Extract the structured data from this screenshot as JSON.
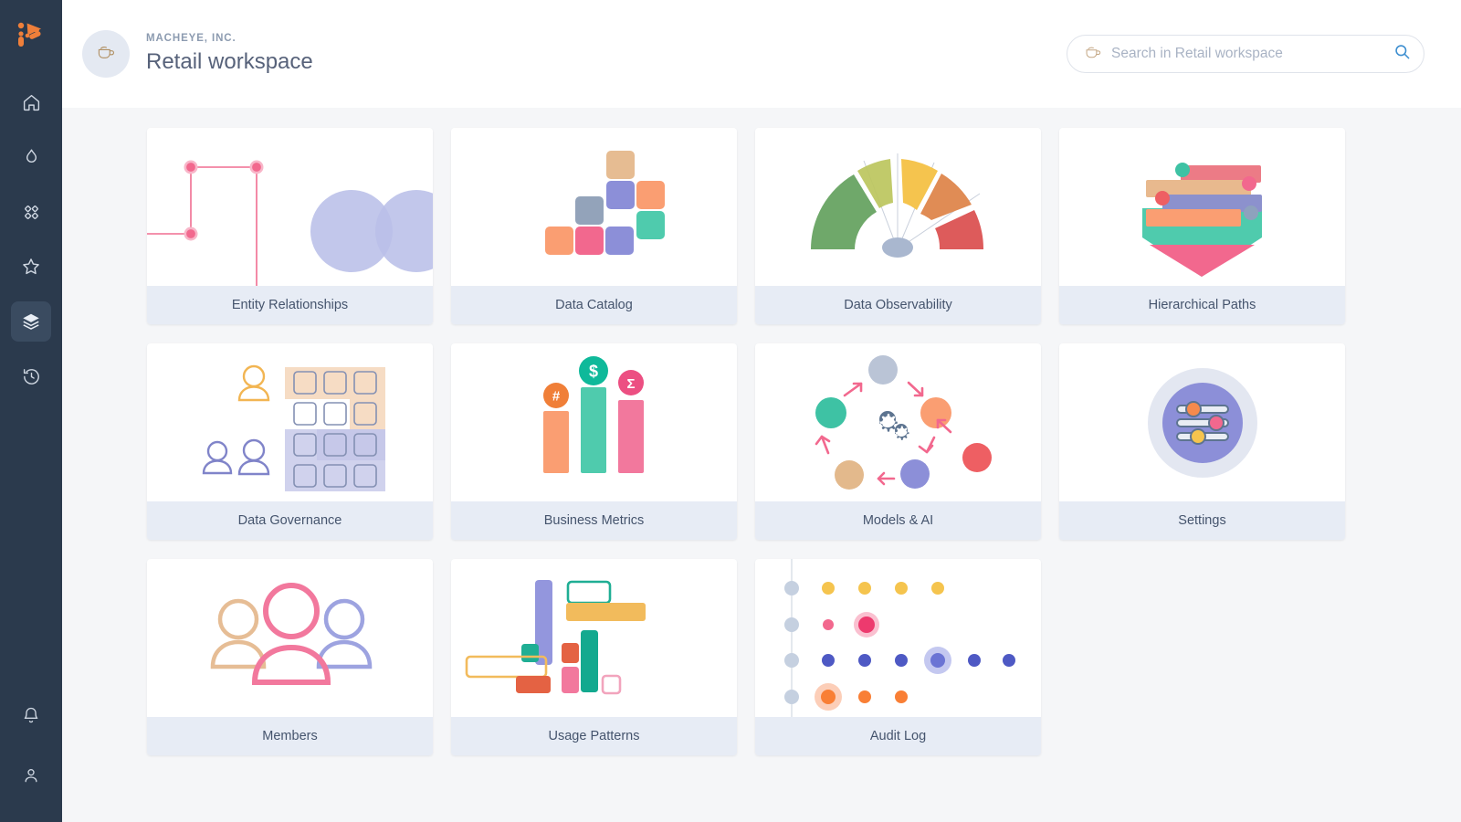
{
  "sidebar": {
    "logo_icon": "macheye-logo-icon",
    "items": [
      {
        "icon": "home-icon",
        "name": "home",
        "active": false
      },
      {
        "icon": "spark-icon",
        "name": "insights",
        "active": false
      },
      {
        "icon": "diamond-grid-icon",
        "name": "apps",
        "active": false
      },
      {
        "icon": "star-icon",
        "name": "favorites",
        "active": false
      },
      {
        "icon": "layers-icon",
        "name": "workspaces",
        "active": true
      },
      {
        "icon": "history-icon",
        "name": "history",
        "active": false
      }
    ],
    "bottom_items": [
      {
        "icon": "bell-icon",
        "name": "notifications"
      },
      {
        "icon": "user-icon",
        "name": "profile"
      }
    ]
  },
  "header": {
    "avatar_icon": "coffee-cup-icon",
    "org": "MACHEYE, INC.",
    "title": "Retail workspace"
  },
  "search": {
    "icon": "coffee-cup-icon",
    "placeholder": "Search in Retail workspace",
    "value": "",
    "submit_icon": "search-icon"
  },
  "cards": [
    {
      "label": "Entity Relationships",
      "art": "entity-relationships"
    },
    {
      "label": "Data Catalog",
      "art": "data-catalog"
    },
    {
      "label": "Data Observability",
      "art": "data-observability"
    },
    {
      "label": "Hierarchical Paths",
      "art": "hierarchical-paths"
    },
    {
      "label": "Data Governance",
      "art": "data-governance"
    },
    {
      "label": "Business Metrics",
      "art": "business-metrics"
    },
    {
      "label": "Models & AI",
      "art": "models-ai"
    },
    {
      "label": "Settings",
      "art": "settings"
    },
    {
      "label": "Members",
      "art": "members"
    },
    {
      "label": "Usage Patterns",
      "art": "usage-patterns"
    },
    {
      "label": "Audit Log",
      "art": "audit-log"
    }
  ],
  "business_metrics_badges": [
    "#",
    "$",
    "Σ"
  ],
  "colors": {
    "sidebar_bg": "#2b3a4d",
    "sidebar_active": "#3a4b60",
    "logo_orange": "#ef7f3a",
    "page_bg": "#f5f6f8",
    "card_bg": "#ffffff",
    "card_label_bg": "#e7ecf5",
    "card_label_text": "#45546d",
    "title_text": "#57627a",
    "org_text": "#8c9bb0",
    "accent_pink": "#ef7a9c",
    "accent_teal": "#45c6ab",
    "accent_orange": "#f89a6b",
    "accent_purple": "#8c8fd8",
    "accent_yellow": "#f5c44e",
    "accent_green": "#6fa86a",
    "accent_red": "#dd5b5b",
    "accent_tan": "#e3b98c",
    "accent_slate": "#93a3ba"
  }
}
